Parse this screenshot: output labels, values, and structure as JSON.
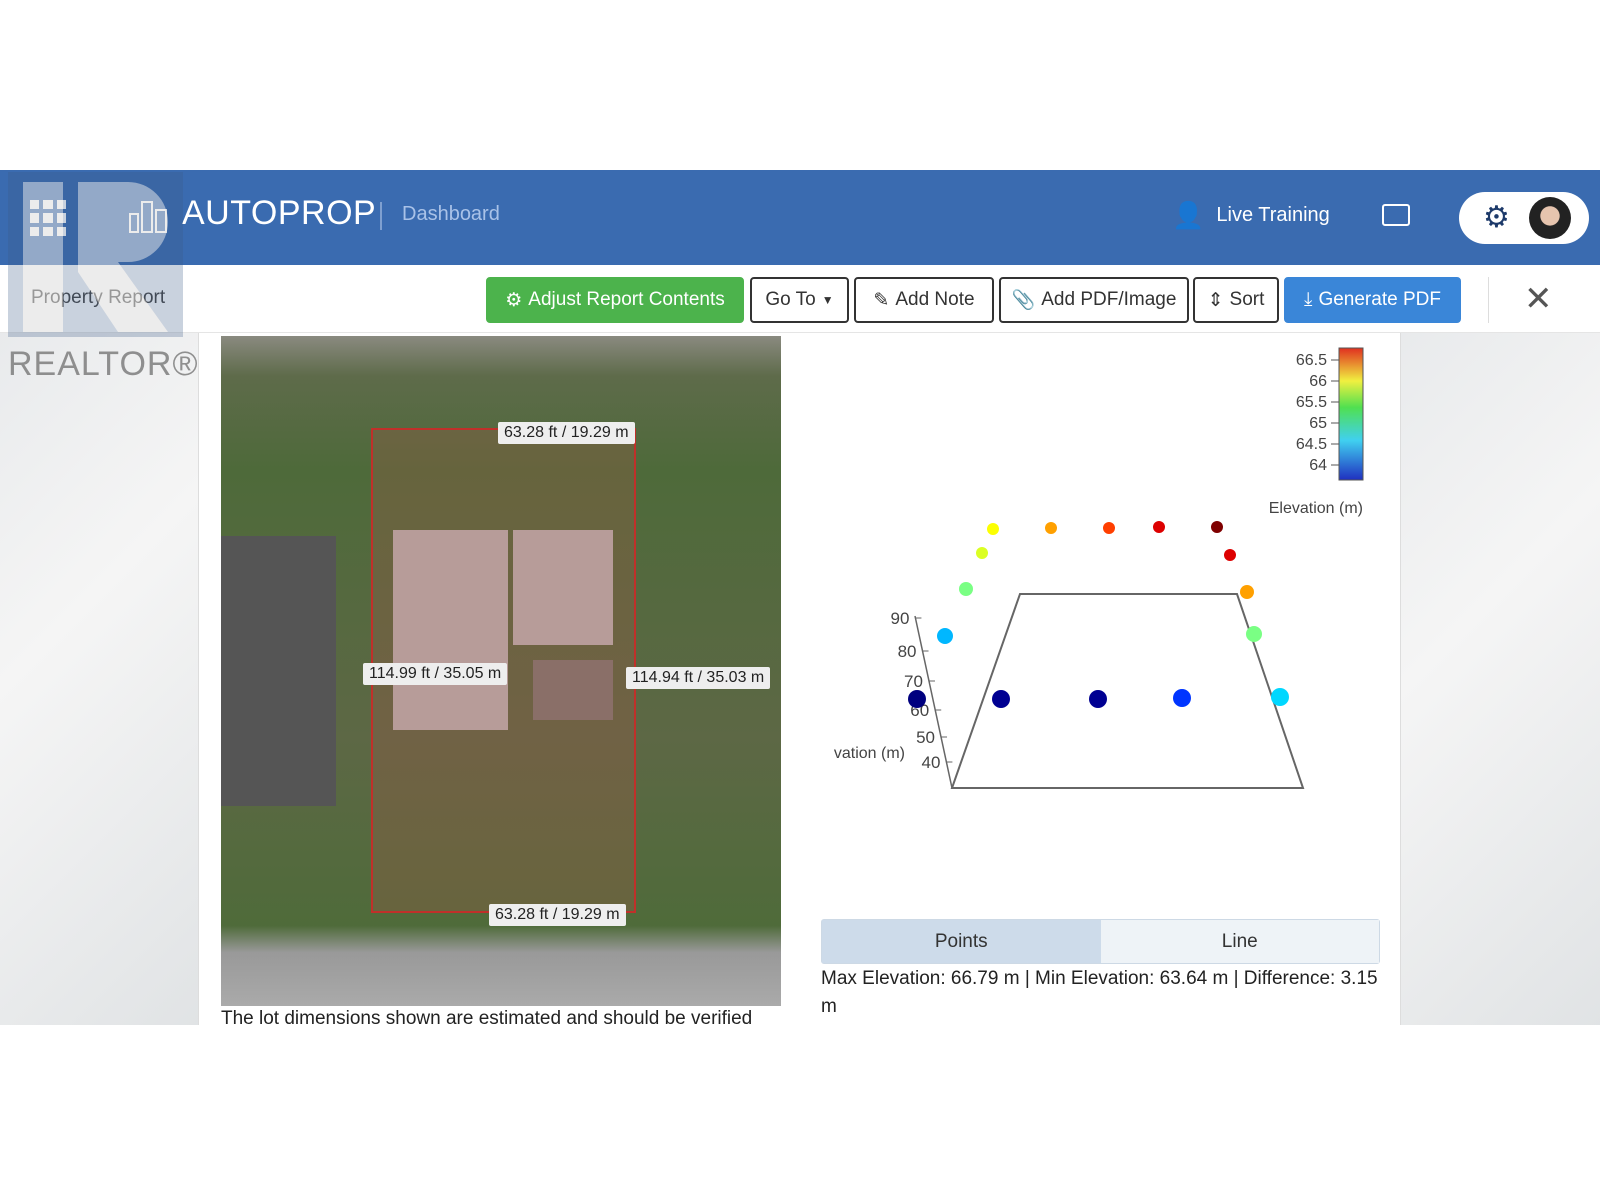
{
  "header": {
    "brand": "AUTOPROP",
    "nav": "Dashboard",
    "live_training": "Live Training"
  },
  "toolbar": {
    "title": "Property Report",
    "adjust": "Adjust Report Contents",
    "goto": "Go To",
    "add_note": "Add Note",
    "add_pdf": "Add PDF/Image",
    "sort": "Sort",
    "generate": "Generate PDF"
  },
  "watermark": {
    "realtor": "REALTOR®"
  },
  "colors": {
    "header": "#3a6bb0",
    "green_button": "#4cb34c",
    "blue_button": "#3a86d8",
    "lot_outline": "#c0302a"
  },
  "lot": {
    "top": "63.28 ft / 19.29 m",
    "bottom": "63.28 ft / 19.29 m",
    "left": "114.99 ft / 35.05 m",
    "right": "114.94 ft / 35.03 m",
    "caption": "The lot dimensions shown are estimated and should be verified"
  },
  "chart_data": {
    "type": "scatter",
    "zlabel": "vation (m)",
    "z_ticks": [
      "90",
      "80",
      "70",
      "60",
      "50",
      "40"
    ],
    "colorbar": {
      "label": "Elevation (m)",
      "ticks": [
        "66.5",
        "66",
        "65.5",
        "65",
        "64.5",
        "64"
      ],
      "range": [
        63.64,
        66.79
      ],
      "colormap": "jet"
    },
    "elevations": [
      63.64,
      63.7,
      63.7,
      64.2,
      64.7,
      65.2,
      65.9,
      66.5,
      66.79,
      66.5,
      66.2,
      65.9,
      65.6,
      65.5,
      65.2,
      64.6
    ]
  },
  "tabs": {
    "points": "Points",
    "line": "Line",
    "active": "Points"
  },
  "stats": "Max Elevation: 66.79 m | Min Elevation: 63.64 m | Difference: 3.15 m"
}
